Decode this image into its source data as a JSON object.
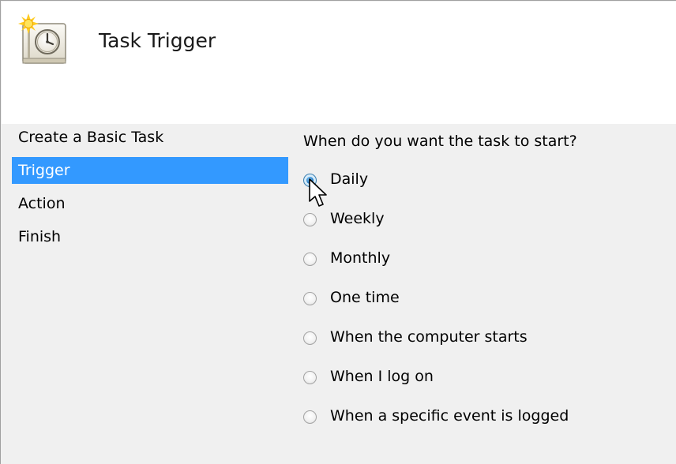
{
  "header": {
    "title": "Task Trigger",
    "icon": "task-scheduler-clock-icon"
  },
  "nav": {
    "items": [
      {
        "label": "Create a Basic Task",
        "active": false
      },
      {
        "label": "Trigger",
        "active": true
      },
      {
        "label": "Action",
        "active": false
      },
      {
        "label": "Finish",
        "active": false
      }
    ]
  },
  "content": {
    "question": "When do you want the task to start?",
    "options": [
      {
        "label": "Daily",
        "checked": true
      },
      {
        "label": "Weekly",
        "checked": false
      },
      {
        "label": "Monthly",
        "checked": false
      },
      {
        "label": "One time",
        "checked": false
      },
      {
        "label": "When the computer starts",
        "checked": false
      },
      {
        "label": "When I log on",
        "checked": false
      },
      {
        "label": "When a specific event is logged",
        "checked": false
      }
    ]
  },
  "colors": {
    "selected_nav_bg": "#3399ff",
    "header_bg": "#ffffff",
    "body_bg": "#f0f0f0"
  }
}
